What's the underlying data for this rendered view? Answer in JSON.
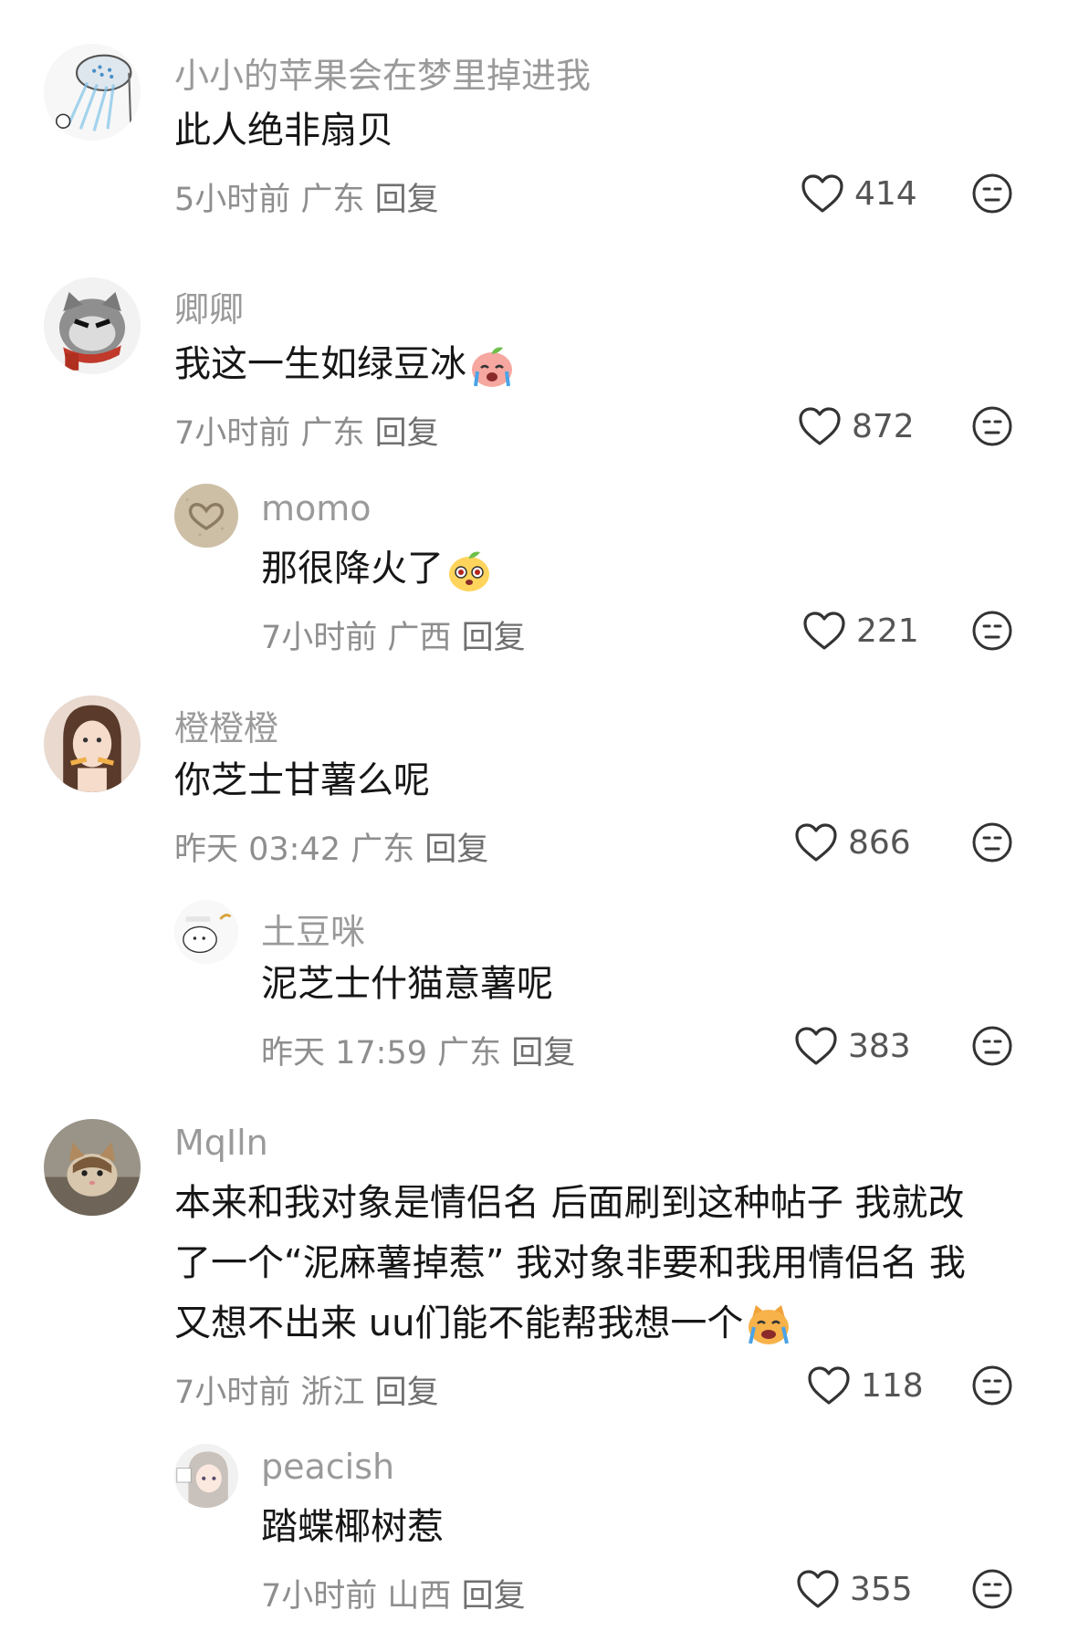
{
  "comments": [
    {
      "username": "小小的苹果会在梦里掉进我",
      "content": "此人绝非扇贝",
      "time": "5小时前",
      "location": "广东",
      "reply_label": "回复",
      "likes": "414",
      "avatar_icon": "shower-cat-avatar"
    },
    {
      "username": "卿卿",
      "content": "我这一生如绿豆冰",
      "content_emoji": "crying-peach-emoji",
      "time": "7小时前",
      "location": "广东",
      "reply_label": "回复",
      "likes": "872",
      "avatar_icon": "grumpy-cat-avatar"
    },
    {
      "username": "momo",
      "content": "那很降火了",
      "content_emoji": "peach-face-emoji",
      "time": "7小时前",
      "location": "广西",
      "reply_label": "回复",
      "likes": "221",
      "avatar_icon": "sand-heart-avatar"
    },
    {
      "username": "橙橙橙",
      "content": "你芝士甘薯么呢",
      "time": "昨天 03:42",
      "location": "广东",
      "reply_label": "回复",
      "likes": "866",
      "avatar_icon": "girl-photo-avatar"
    },
    {
      "username": "土豆咪",
      "content": "泥芝士什猫意薯呢",
      "time": "昨天 17:59",
      "location": "广东",
      "reply_label": "回复",
      "likes": "383",
      "avatar_icon": "doodle-avatar"
    },
    {
      "username": "MqIln",
      "content_lines": [
        "本来和我对象是情侣名 后面刷到这种帖子 我就改",
        "了一个“泥麻薯掉惹” 我对象非要和我用情侣名 我",
        "又想不出来 uu们能不能帮我想一个"
      ],
      "content_emoji": "crying-cat-emoji",
      "time": "7小时前",
      "location": "浙江",
      "reply_label": "回复",
      "likes": "118",
      "avatar_icon": "kitten-photo-avatar"
    },
    {
      "username": "peacish",
      "content": "踏蝶椰树惹",
      "time": "7小时前",
      "location": "山西",
      "reply_label": "回复",
      "likes": "355",
      "avatar_icon": "anime-girl-avatar"
    }
  ],
  "colors": {
    "username": "#9a9a9a",
    "meta": "#8e8e8e",
    "icon": "#333333"
  }
}
